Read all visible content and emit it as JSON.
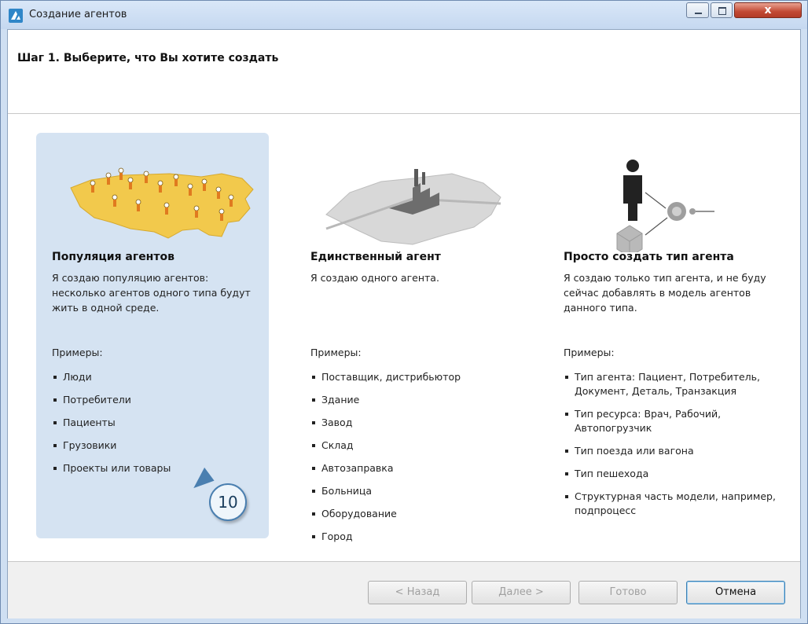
{
  "window": {
    "title": "Создание агентов",
    "close_label": "x"
  },
  "header": {
    "step_title": "Шаг 1. Выберите, что Вы хотите создать"
  },
  "cards": [
    {
      "title": "Популяция агентов",
      "description": "Я создаю популяцию агентов: несколько агентов одного типа будут жить в одной среде.",
      "examples_label": "Примеры:",
      "examples": [
        "Люди",
        "Потребители",
        "Пациенты",
        "Грузовики",
        "Проекты или товары"
      ],
      "selected": true
    },
    {
      "title": "Единственный агент",
      "description": "Я создаю одного агента.",
      "examples_label": "Примеры:",
      "examples": [
        "Поставщик, дистрибьютор",
        "Здание",
        "Завод",
        "Склад",
        "Автозаправка",
        "Больница",
        "Оборудование",
        "Город"
      ],
      "selected": false
    },
    {
      "title": "Просто создать тип агента",
      "description": "Я создаю только тип агента, и не буду сейчас добавлять в модель агентов данного типа.",
      "examples_label": "Примеры:",
      "examples": [
        "Тип агента: Пациент, Потребитель, Документ, Деталь, Транзакция",
        "Тип ресурса: Врач, Рабочий, Автопогрузчик",
        "Тип поезда или вагона",
        "Тип пешехода",
        "Структурная часть модели, например, подпроцесс"
      ],
      "selected": false
    }
  ],
  "callout": {
    "number": "10"
  },
  "footer": {
    "back": "< Назад",
    "next": "Далее >",
    "finish": "Готово",
    "cancel": "Отмена"
  }
}
